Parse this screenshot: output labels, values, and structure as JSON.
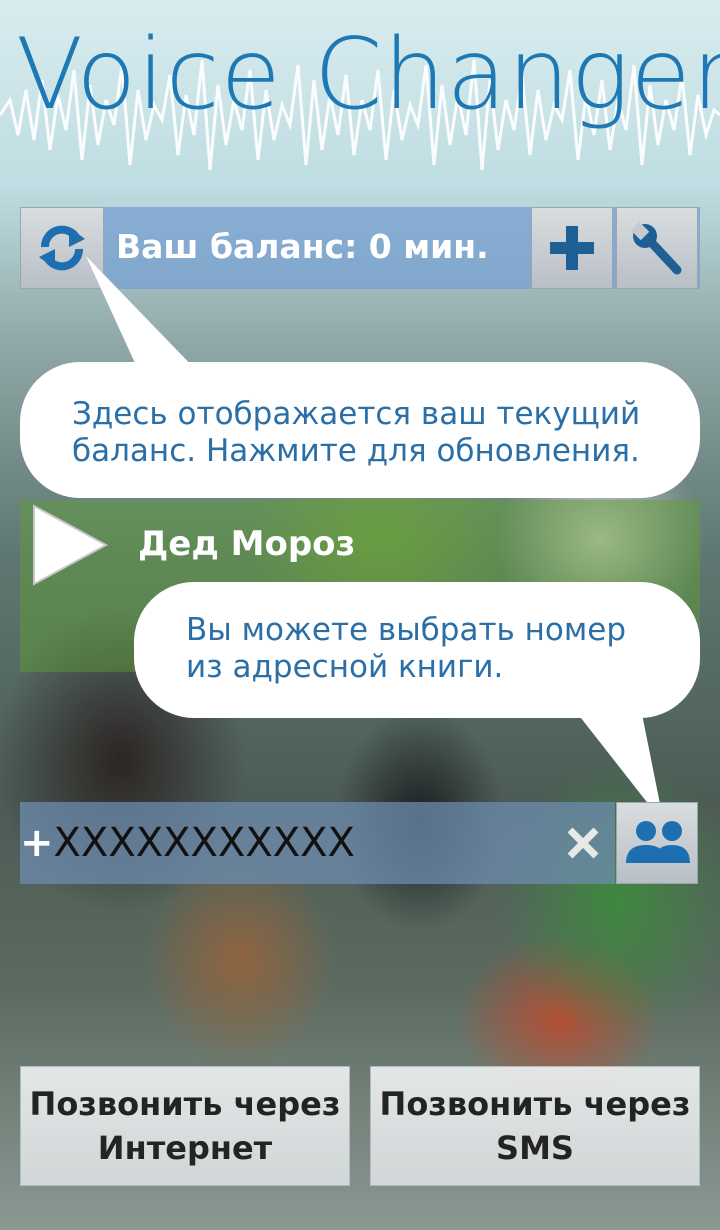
{
  "app": {
    "title": "Voice Changer"
  },
  "header": {
    "balance_label": "Ваш баланс: 0 мин."
  },
  "hints": {
    "balance_hint": "Здесь отображается ваш текущий баланс. Нажмите для обновления.",
    "contacts_hint": "Вы можете выбрать номер из адресной книги."
  },
  "voice": {
    "selected_name": "Дед Мороз"
  },
  "phone": {
    "prefix": "+",
    "value": "XXXXXXXXXXX"
  },
  "actions": {
    "call_internet_line1": "Позвонить через",
    "call_internet_line2": "Интернет",
    "call_sms_line1": "Позвонить через",
    "call_sms_line2": "SMS"
  },
  "colors": {
    "title_blue": "#1e78b4",
    "hint_text": "#2a6fa8",
    "balance_bar": "#78a0d2",
    "voice_row": "#5fa032"
  },
  "icons": {
    "refresh": "refresh-icon",
    "add_balance": "plus-icon",
    "settings": "wrench-icon",
    "play": "play-icon",
    "clear": "close-icon",
    "contacts": "contacts-icon"
  }
}
